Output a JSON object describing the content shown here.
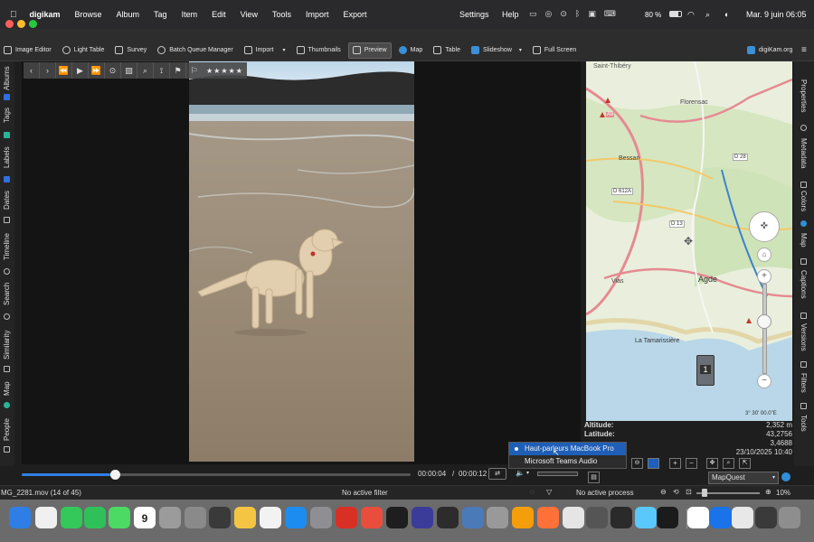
{
  "menubar": {
    "app_name": "digikam",
    "menus": [
      "Browse",
      "Album",
      "Tag",
      "Item",
      "Edit",
      "View",
      "Tools",
      "Import",
      "Export"
    ],
    "right_menus": [
      "Settings",
      "Help"
    ],
    "battery": "80 %",
    "datetime": "Mar. 9 juin  06:05"
  },
  "toolbar": {
    "image_editor": "Image Editor",
    "light_table": "Light Table",
    "survey": "Survey",
    "batch_queue": "Batch Queue Manager",
    "import": "Import",
    "thumbnails": "Thumbnails",
    "preview": "Preview",
    "map": "Map",
    "table": "Table",
    "slideshow": "Slideshow",
    "full_screen": "Full Screen",
    "website": "digiKam.org"
  },
  "left_tabs": [
    "Albums",
    "Tags",
    "Labels",
    "Dates",
    "Timeline",
    "Search",
    "Similarity",
    "Map",
    "People"
  ],
  "right_tabs": [
    "Properties",
    "Metadata",
    "Colors",
    "Map",
    "Captions",
    "Versions",
    "Filters",
    "Tools"
  ],
  "preview": {
    "rating_stars": "★★★★★",
    "time_current": "00:00:04",
    "time_sep": "/",
    "time_total": "00:00:12",
    "progress": 0.24
  },
  "map": {
    "places": {
      "saint_thibery": "Saint-Thibéry",
      "florensac": "Florensac",
      "bessan": "Bessan",
      "vias": "Vias",
      "agde": "Agde",
      "la_tamarissiere": "La Tamarissière"
    },
    "roads": {
      "d28": "D 28",
      "d612a": "D 612A",
      "d13": "D 13",
      "a9": "A9"
    },
    "photo_count": "1",
    "coords": "3° 30' 00.0\"E",
    "provider": "MapQuest"
  },
  "geo": {
    "altitude_label": "Altitude:",
    "altitude": "2,352 m",
    "latitude_label": "Latitude:",
    "latitude": "43,2756",
    "longitude": "3,4688",
    "date": "23/10/2025 10:40"
  },
  "audio_popup": {
    "options": [
      "Haut-parleurs MacBook Pro",
      "Microsoft Teams Audio"
    ],
    "selected": 0
  },
  "status": {
    "filename": "MG_2281.mov (14 of 45)",
    "filter": "No active filter",
    "process": "No active process",
    "zoom": "10%"
  },
  "dock": {
    "calendar_day": "9",
    "colors": [
      "#2f7ee6",
      "#f0f0f0",
      "#34c759",
      "#30c05a",
      "#4cd964",
      "#ffffff",
      "#9b9b9b",
      "#8a8a8a",
      "#3a3a3a",
      "#f4c542",
      "#f2f2f2",
      "#1c8cf0",
      "#8e8e93",
      "#d93025",
      "#e94e3c",
      "#1e1e1e",
      "#3b3b9a",
      "#2c2c2c",
      "#4a7ab8",
      "#999999",
      "#f59e0b",
      "#ff7139",
      "#e5e5e5",
      "#555555",
      "#2a2a2a",
      "#5ac8fa",
      "#1b1b1b",
      "#ffffff",
      "#1a73e8",
      "#e8e8e8",
      "#3a3a3a",
      "#8e8e8e"
    ]
  }
}
